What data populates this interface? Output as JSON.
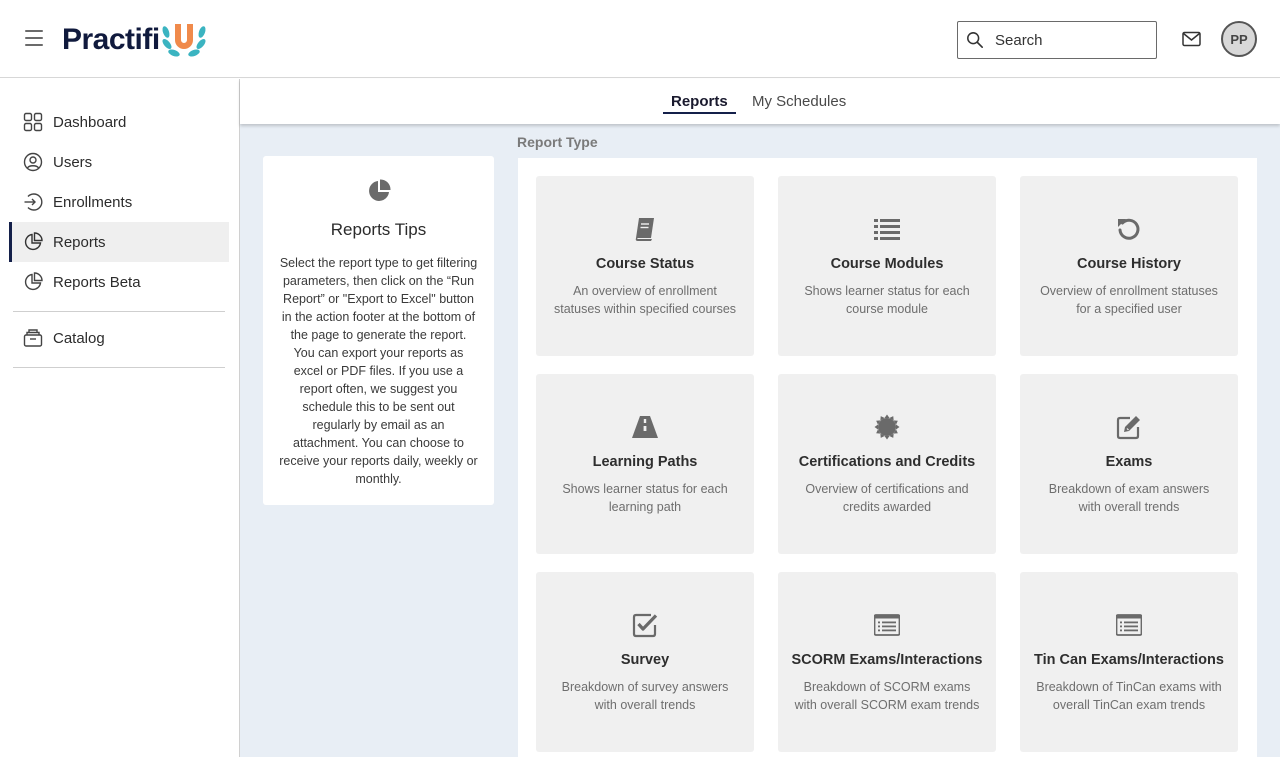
{
  "header": {
    "brand": "Practifi",
    "search_placeholder": "Search",
    "avatar_initials": "PP"
  },
  "sidebar": {
    "items": [
      {
        "label": "Dashboard",
        "icon": "grid-icon"
      },
      {
        "label": "Users",
        "icon": "user-circle-icon"
      },
      {
        "label": "Enrollments",
        "icon": "enter-arrow-icon"
      },
      {
        "label": "Reports",
        "icon": "pie-chart-icon",
        "active": true
      },
      {
        "label": "Reports Beta",
        "icon": "pie-chart-icon"
      },
      {
        "label": "Catalog",
        "icon": "archive-box-icon"
      }
    ]
  },
  "tabs": [
    {
      "label": "Reports",
      "active": true
    },
    {
      "label": "My Schedules",
      "active": false
    }
  ],
  "tips": {
    "title": "Reports Tips",
    "body": "Select the report type to get filtering parameters, then click on the “Run Report” or \"Export to Excel\" button in the action footer at the bottom of the page to generate the report. You can export your reports as excel or PDF files. If you use a report often, we suggest you schedule this to be sent out regularly by email as an attachment. You can choose to receive your reports daily, weekly or monthly."
  },
  "report_type_label": "Report Type",
  "reports": [
    {
      "title": "Course Status",
      "desc": "An overview of enrollment statuses within specified courses",
      "icon": "book-icon"
    },
    {
      "title": "Course Modules",
      "desc": "Shows learner status for each course module",
      "icon": "list-icon"
    },
    {
      "title": "Course History",
      "desc": "Overview of enrollment statuses for a specified user",
      "icon": "history-icon"
    },
    {
      "title": "Learning Paths",
      "desc": "Shows learner status for each learning path",
      "icon": "road-icon"
    },
    {
      "title": "Certifications and Credits",
      "desc": "Overview of certifications and credits awarded",
      "icon": "certificate-icon"
    },
    {
      "title": "Exams",
      "desc": "Breakdown of exam answers with overall trends",
      "icon": "edit-icon"
    },
    {
      "title": "Survey",
      "desc": "Breakdown of survey answers with overall trends",
      "icon": "check-square-icon"
    },
    {
      "title": "SCORM Exams/Interactions",
      "desc": "Breakdown of SCORM exams with overall SCORM exam trends",
      "icon": "list-window-icon"
    },
    {
      "title": "Tin Can Exams/Interactions",
      "desc": "Breakdown of TinCan exams with overall TinCan exam trends",
      "icon": "list-window-icon"
    }
  ],
  "colors": {
    "brand_navy": "#14204a",
    "logo_orange": "#f08a4b",
    "logo_teal": "#3bb4c1",
    "main_bg": "#e8eef5",
    "card_bg": "#f0f0f0"
  }
}
